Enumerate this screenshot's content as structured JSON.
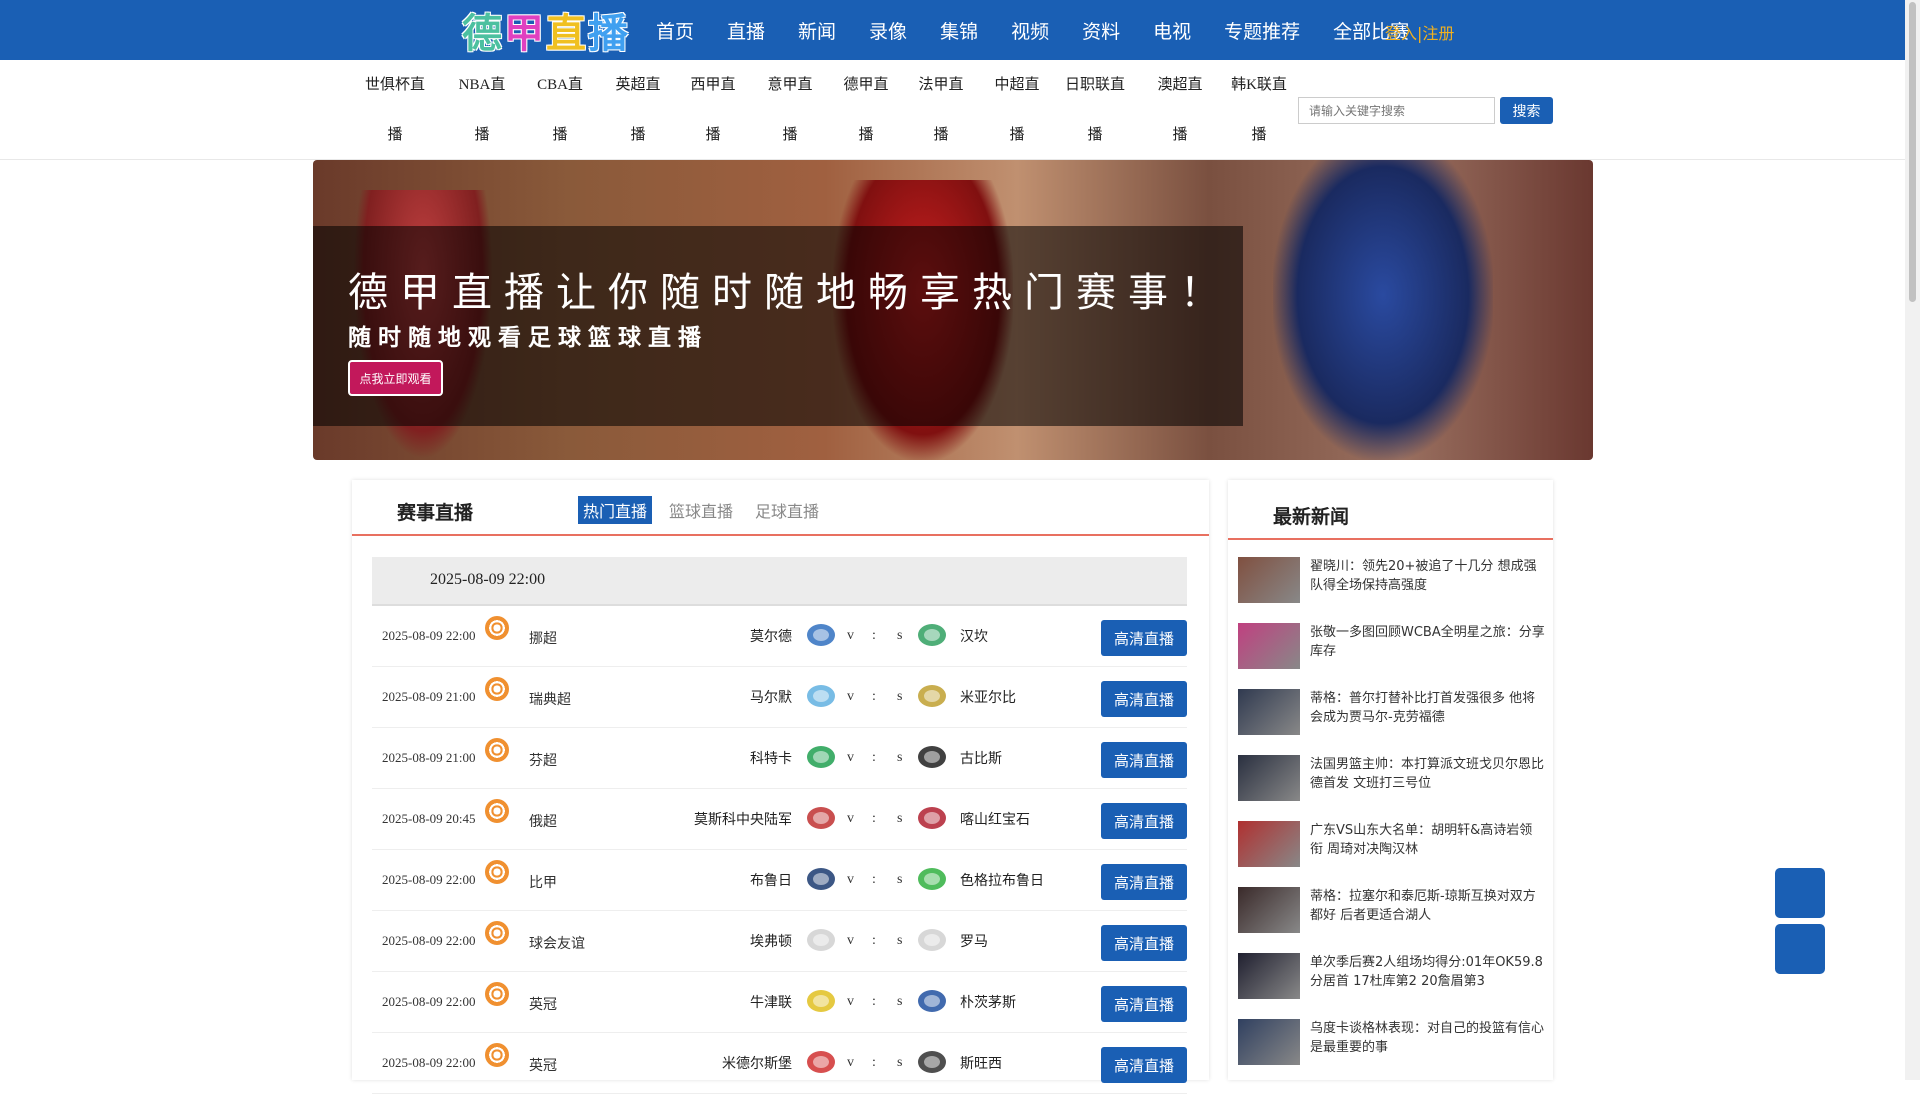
{
  "header": {
    "logo_chars": [
      "德",
      "甲",
      "直",
      "播"
    ],
    "logo_colors": [
      "#4cc0a0",
      "#e040c0",
      "#f0c020",
      "#40a0f0"
    ],
    "nav": [
      "首页",
      "直播",
      "新闻",
      "录像",
      "集锦",
      "视频",
      "资料",
      "电视",
      "专题推荐",
      "全部比赛"
    ],
    "login": "登入|注册"
  },
  "subnav": [
    {
      "l1": "世俱杯直",
      "l2": "播"
    },
    {
      "l1": "NBA直",
      "l2": "播"
    },
    {
      "l1": "CBA直",
      "l2": "播"
    },
    {
      "l1": "英超直",
      "l2": "播"
    },
    {
      "l1": "西甲直",
      "l2": "播"
    },
    {
      "l1": "意甲直",
      "l2": "播"
    },
    {
      "l1": "德甲直",
      "l2": "播"
    },
    {
      "l1": "法甲直",
      "l2": "播"
    },
    {
      "l1": "中超直",
      "l2": "播"
    },
    {
      "l1": "日职联直",
      "l2": "播"
    },
    {
      "l1": "澳超直",
      "l2": "播"
    },
    {
      "l1": "韩K联直",
      "l2": "播"
    }
  ],
  "search": {
    "placeholder": "请输入关键字搜索",
    "button": "搜索"
  },
  "banner": {
    "headline": "德甲直播让你随时随地畅享热门赛事！",
    "subline": "随时随地观看足球篮球直播",
    "cta": "点我立即观看"
  },
  "matches": {
    "title": "赛事直播",
    "tabs": [
      "热门直播",
      "篮球直播",
      "足球直播"
    ],
    "active_tab": 0,
    "date": "2025-08-09 22:00",
    "vs": "v",
    "colon": ":",
    "s": "s",
    "watch_label": "高清直播",
    "rows": [
      {
        "time": "2025-08-09 22:00",
        "league": "挪超",
        "home": "莫尔德",
        "away": "汉坎",
        "home_color": "#3070c0",
        "away_color": "#30a060"
      },
      {
        "time": "2025-08-09 21:00",
        "league": "瑞典超",
        "home": "马尔默",
        "away": "米亚尔比",
        "home_color": "#60b0e0",
        "away_color": "#c0a030"
      },
      {
        "time": "2025-08-09 21:00",
        "league": "芬超",
        "home": "科特卡",
        "away": "古比斯",
        "home_color": "#20a050",
        "away_color": "#202020"
      },
      {
        "time": "2025-08-09 20:45",
        "league": "俄超",
        "home": "莫斯科中央陆军",
        "away": "喀山红宝石",
        "home_color": "#c03030",
        "away_color": "#b02030"
      },
      {
        "time": "2025-08-09 22:00",
        "league": "比甲",
        "home": "布鲁日",
        "away": "色格拉布鲁日",
        "home_color": "#1a3a70",
        "away_color": "#30b040"
      },
      {
        "time": "2025-08-09 22:00",
        "league": "球会友谊",
        "home": "埃弗顿",
        "away": "罗马",
        "home_color": "#d0d0d0",
        "away_color": "#d0d0d0"
      },
      {
        "time": "2025-08-09 22:00",
        "league": "英冠",
        "home": "牛津联",
        "away": "朴茨茅斯",
        "home_color": "#e0c020",
        "away_color": "#2050a0"
      },
      {
        "time": "2025-08-09 22:00",
        "league": "英冠",
        "home": "米德尔斯堡",
        "away": "斯旺西",
        "home_color": "#d03030",
        "away_color": "#303030"
      }
    ]
  },
  "news": {
    "title": "最新新闻",
    "items": [
      {
        "text": "翟晓川：领先20+被追了十几分 想成强队得全场保持高强度",
        "color": "#805040"
      },
      {
        "text": "张敬一多图回顾WCBA全明星之旅：分享库存",
        "color": "#c04080"
      },
      {
        "text": "蒂格：普尔打替补比打首发强很多 他将会成为贾马尔-克劳福德",
        "color": "#303a50"
      },
      {
        "text": "法国男篮主帅：本打算派文班戈贝尔恩比德首发 文班打三号位",
        "color": "#2a3040"
      },
      {
        "text": "广东VS山东大名单：胡明轩&高诗岩领衔 周琦对决陶汉林",
        "color": "#b03030"
      },
      {
        "text": "蒂格：拉塞尔和泰厄斯-琼斯互换对双方都好 后者更适合湖人",
        "color": "#3a2a2a"
      },
      {
        "text": "单次季后赛2人组场均得分:01年OK59.8分居首 17杜库第2 20詹眉第3",
        "color": "#202030"
      },
      {
        "text": "乌度卡谈格林表现：对自己的投篮有信心是最重要的事",
        "color": "#304060"
      }
    ]
  }
}
